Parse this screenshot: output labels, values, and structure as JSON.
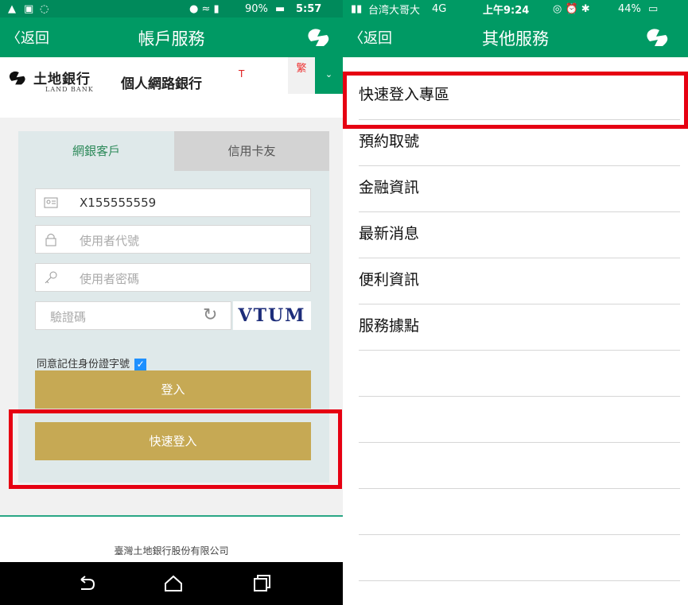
{
  "left": {
    "status": {
      "battery": "90%",
      "time": "5:57"
    },
    "topbar": {
      "back": "〈返回",
      "title": "帳戶服務"
    },
    "bank": {
      "name_cn": "土地銀行",
      "name_en": "LAND   BANK",
      "ebank": "個人網路銀行",
      "ebank_sup": "T",
      "lang": "繁",
      "lang_drop": "⌄"
    },
    "tabs": {
      "customer": "網銀客戶",
      "card": "信用卡友"
    },
    "form": {
      "id_value": "X155555559",
      "user_placeholder": "使用者代號",
      "pass_placeholder": "使用者密碼",
      "captcha_placeholder": "驗證碼",
      "captcha_text": "VTUM"
    },
    "remember": "同意記住身份證字號",
    "login_btn": "登入",
    "quick_login_btn": "快速登入",
    "footer": "臺灣土地銀行股份有限公司"
  },
  "right": {
    "status": {
      "carrier": "台湾大哥大",
      "network": "4G",
      "time": "上午9:24",
      "battery": "44%"
    },
    "topbar": {
      "back": "〈返回",
      "title": "其他服務"
    },
    "items": [
      "快速登入專區",
      "預約取號",
      "金融資訊",
      "最新消息",
      "便利資訊",
      "服務據點"
    ]
  },
  "colors": {
    "brand_green": "#009a64",
    "gold": "#c6a954",
    "highlight_red": "#e60012"
  }
}
